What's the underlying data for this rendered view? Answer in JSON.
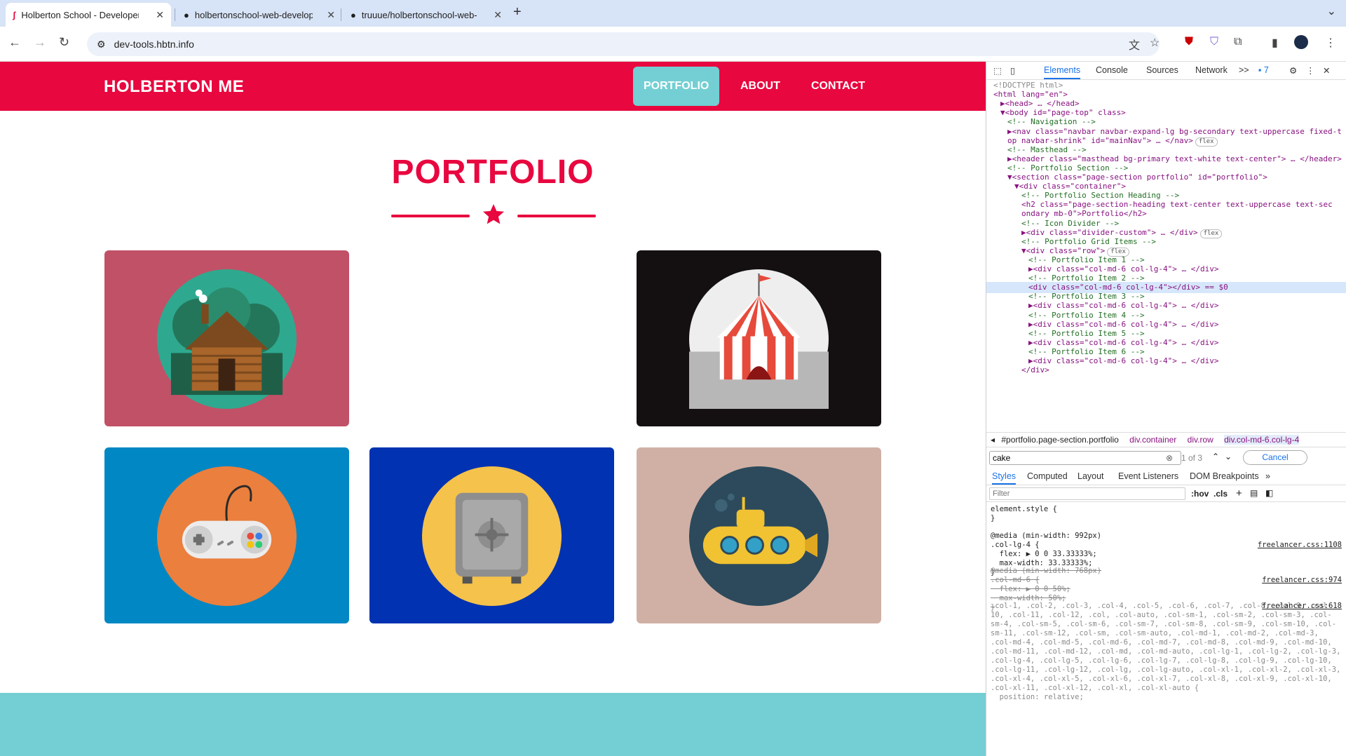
{
  "browser": {
    "tabs": [
      {
        "title": "Holberton School - Developer",
        "active": true
      },
      {
        "title": "holbertonschool-web-develop",
        "active": false
      },
      {
        "title": "truuue/holbertonschool-web-",
        "active": false
      }
    ],
    "url": "dev-tools.hbtn.info"
  },
  "site": {
    "brand": "HOLBERTON ME",
    "nav": [
      {
        "label": "PORTFOLIO",
        "active": true
      },
      {
        "label": "ABOUT",
        "active": false
      },
      {
        "label": "CONTACT",
        "active": false
      }
    ],
    "section_title": "PORTFOLIO",
    "colors": {
      "primary": "#e8073f",
      "secondary": "#73cfd3"
    },
    "cards": [
      {
        "icon": "cabin-icon",
        "bg": "#c15167"
      },
      {
        "icon": "circus-tent-icon",
        "bg": "#141011"
      },
      {
        "icon": "game-controller-icon",
        "bg": "#0087c4"
      },
      {
        "icon": "safe-icon",
        "bg": "#0132b1"
      },
      {
        "icon": "submarine-icon",
        "bg": "#d0b0a5"
      }
    ]
  },
  "devtools": {
    "tabs": [
      "Elements",
      "Console",
      "Sources",
      "Network"
    ],
    "more_tabs": ">>",
    "issues_count": "7",
    "dom_lines": [
      {
        "indent": 0,
        "html": "<!DOCTYPE html>",
        "cls": "grey"
      },
      {
        "indent": 0,
        "html": "<html lang=\"en\">"
      },
      {
        "indent": 1,
        "html": "▶<head> … </head>"
      },
      {
        "indent": 1,
        "html": "▼<body id=\"page-top\" class>"
      },
      {
        "indent": 2,
        "html": "<!-- Navigation -->",
        "cls": "cm"
      },
      {
        "indent": 2,
        "html": "▶<nav class=\"navbar navbar-expand-lg bg-secondary text-uppercase fixed-t"
      },
      {
        "indent": 2,
        "html": "op navbar-shrink\" id=\"mainNav\"> … </nav>",
        "pill": "flex"
      },
      {
        "indent": 2,
        "html": "<!-- Masthead -->",
        "cls": "cm"
      },
      {
        "indent": 2,
        "html": "▶<header class=\"masthead bg-primary text-white text-center\"> … </header>"
      },
      {
        "indent": 2,
        "html": "<!-- Portfolio Section -->",
        "cls": "cm"
      },
      {
        "indent": 2,
        "html": "▼<section class=\"page-section portfolio\" id=\"portfolio\">"
      },
      {
        "indent": 3,
        "html": "▼<div class=\"container\">"
      },
      {
        "indent": 4,
        "html": "<!-- Portfolio Section Heading -->",
        "cls": "cm"
      },
      {
        "indent": 4,
        "html": "<h2 class=\"page-section-heading text-center text-uppercase text-sec"
      },
      {
        "indent": 4,
        "html": "ondary mb-0\">Portfolio</h2>"
      },
      {
        "indent": 4,
        "html": "<!-- Icon Divider -->",
        "cls": "cm"
      },
      {
        "indent": 4,
        "html": "▶<div class=\"divider-custom\"> … </div>",
        "pill": "flex"
      },
      {
        "indent": 4,
        "html": "<!-- Portfolio Grid Items -->",
        "cls": "cm"
      },
      {
        "indent": 4,
        "html": "▼<div class=\"row\">",
        "pill": "flex"
      },
      {
        "indent": 5,
        "html": "<!-- Portfolio Item 1 -->",
        "cls": "cm"
      },
      {
        "indent": 5,
        "html": "▶<div class=\"col-md-6 col-lg-4\"> … </div>"
      },
      {
        "indent": 5,
        "html": "<!-- Portfolio Item 2 -->",
        "cls": "cm"
      },
      {
        "indent": 5,
        "html": "<div class=\"col-md-6 col-lg-4\"></div> == $0",
        "sel": true
      },
      {
        "indent": 5,
        "html": "<!-- Portfolio Item 3 -->",
        "cls": "cm"
      },
      {
        "indent": 5,
        "html": "▶<div class=\"col-md-6 col-lg-4\"> … </div>"
      },
      {
        "indent": 5,
        "html": "<!-- Portfolio Item 4 -->",
        "cls": "cm"
      },
      {
        "indent": 5,
        "html": "▶<div class=\"col-md-6 col-lg-4\"> … </div>"
      },
      {
        "indent": 5,
        "html": "<!-- Portfolio Item 5 -->",
        "cls": "cm"
      },
      {
        "indent": 5,
        "html": "▶<div class=\"col-md-6 col-lg-4\"> … </div>"
      },
      {
        "indent": 5,
        "html": "<!-- Portfolio Item 6 -->",
        "cls": "cm"
      },
      {
        "indent": 5,
        "html": "▶<div class=\"col-md-6 col-lg-4\"> … </div>"
      },
      {
        "indent": 4,
        "html": "</div>"
      }
    ],
    "breadcrumbs": [
      "#portfolio.page-section.portfolio",
      "div.container",
      "div.row",
      "div.col-md-6.col-lg-4"
    ],
    "search": {
      "value": "cake",
      "count": "1 of 3",
      "cancel": "Cancel"
    },
    "style_tabs": [
      "Styles",
      "Computed",
      "Layout",
      "Event Listeners",
      "DOM Breakpoints"
    ],
    "filter_placeholder": "Filter",
    "filter_buttons": [
      ":hov",
      ".cls"
    ],
    "rules": [
      {
        "text": "element.style {\n}",
        "source": ""
      },
      {
        "text": "@media (min-width: 992px)\n.col-lg-4 {\n  flex: ▶ 0 0 33.33333%;\n  max-width: 33.33333%;\n}",
        "source": "freelancer.css:1108"
      },
      {
        "text": "@media (min-width: 768px)\n.col-md-6 {\n  flex: ▶ 0 0 50%;\n  max-width: 50%;\n}",
        "source": "freelancer.css:974"
      },
      {
        "text": ".col-1, .col-2, .col-3, .col-4, .col-5, .col-6, .col-7, .col-8, .col-9, .col-10, .col-11, .col-12, .col, .col-auto, .col-sm-1, .col-sm-2, .col-sm-3, .col-sm-4, .col-sm-5, .col-sm-6, .col-sm-7, .col-sm-8, .col-sm-9, .col-sm-10, .col-sm-11, .col-sm-12, .col-sm, .col-sm-auto, .col-md-1, .col-md-2, .col-md-3, .col-md-4, .col-md-5, .col-md-6, .col-md-7, .col-md-8, .col-md-9, .col-md-10, .col-md-11, .col-md-12, .col-md, .col-md-auto, .col-lg-1, .col-lg-2, .col-lg-3, .col-lg-4, .col-lg-5, .col-lg-6, .col-lg-7, .col-lg-8, .col-lg-9, .col-lg-10, .col-lg-11, .col-lg-12, .col-lg, .col-lg-auto, .col-xl-1, .col-xl-2, .col-xl-3, .col-xl-4, .col-xl-5, .col-xl-6, .col-xl-7, .col-xl-8, .col-xl-9, .col-xl-10, .col-xl-11, .col-xl-12, .col-xl, .col-xl-auto {\n  position: relative;",
        "source": "freelancer.css:618"
      }
    ]
  }
}
